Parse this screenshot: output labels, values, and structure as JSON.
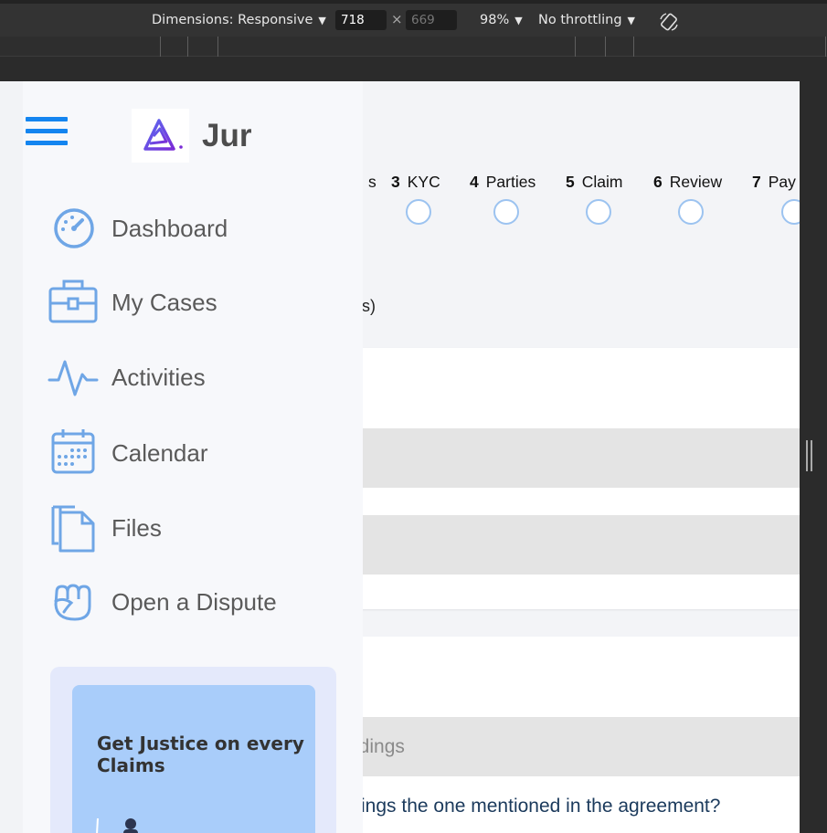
{
  "devtools": {
    "dimensions_label": "Dimensions: Responsive",
    "width": "718",
    "height": "669",
    "times": "×",
    "zoom": "98%",
    "throttling": "No throttling",
    "caret": "▼"
  },
  "app": {
    "brand": "Jur",
    "nav": [
      {
        "label": "Dashboard",
        "icon": "dashboard-gauge-icon"
      },
      {
        "label": "My Cases",
        "icon": "briefcase-icon"
      },
      {
        "label": "Activities",
        "icon": "activity-pulse-icon"
      },
      {
        "label": "Calendar",
        "icon": "calendar-icon"
      },
      {
        "label": "Files",
        "icon": "files-icon"
      },
      {
        "label": "Open a Dispute",
        "icon": "fist-icon"
      }
    ],
    "promo_text": "Get Justice on every Claims",
    "accent": "#1485f0",
    "icon_color": "#6fa6e6"
  },
  "steps": [
    {
      "num": "",
      "label": "s"
    },
    {
      "num": "3",
      "label": "KYC"
    },
    {
      "num": "4",
      "label": "Parties"
    },
    {
      "num": "5",
      "label": "Claim"
    },
    {
      "num": "6",
      "label": "Review"
    },
    {
      "num": "7",
      "label": "Pay"
    }
  ],
  "form": {
    "partial_label": "s)",
    "partial_placeholder": "edings",
    "partial_question": "ings the one mentioned in the agreement?"
  }
}
